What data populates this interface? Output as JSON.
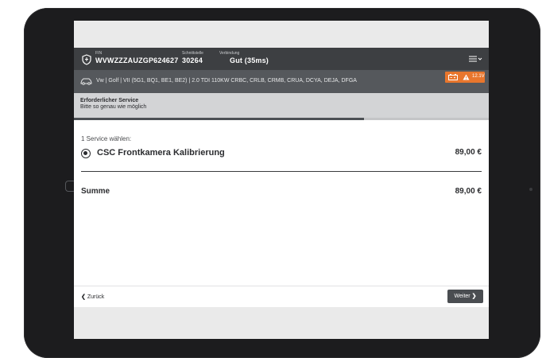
{
  "header": {
    "fin_label": "FIN",
    "fin_value": "WVWZZZAUZGP624627",
    "interface_label": "Schnittstelle",
    "interface_value": "30264",
    "connection_label": "Verbindung",
    "connection_value": "Gut (35ms)",
    "icons": {
      "left": "shield-icon",
      "right": "menu-icon"
    }
  },
  "vehicle": {
    "description": "Vw | Golf | VII (5G1, BQ1, BE1, BE2) | 2.0 TDI 110KW CRBC, CRLB, CRMB, CRUA, DCYA, DEJA, DFGA",
    "battery_voltage": "12.1V",
    "icons": [
      "car-icon",
      "battery-icon",
      "warning-icon"
    ]
  },
  "step": {
    "title": "Erforderlicher Service",
    "subtitle": "Bitte so genau wie möglich",
    "progress_fraction": 0.7
  },
  "content": {
    "select_label": "1 Service wählen:",
    "service": {
      "name": "CSC Frontkamera Kalibrierung",
      "price": "89,00 €",
      "selected": true
    },
    "sum_label": "Summe",
    "sum_value": "89,00 €"
  },
  "footer": {
    "back_label": "Zurück",
    "next_label": "Weiter"
  },
  "colors": {
    "header_bg": "#3d3f42",
    "vehicle_bar_bg": "#55585c",
    "battery_badge": "#e8762d",
    "step_bar_bg": "#d3d4d6",
    "progress_fill": "#4c5054",
    "next_button": "#4a4d51"
  }
}
